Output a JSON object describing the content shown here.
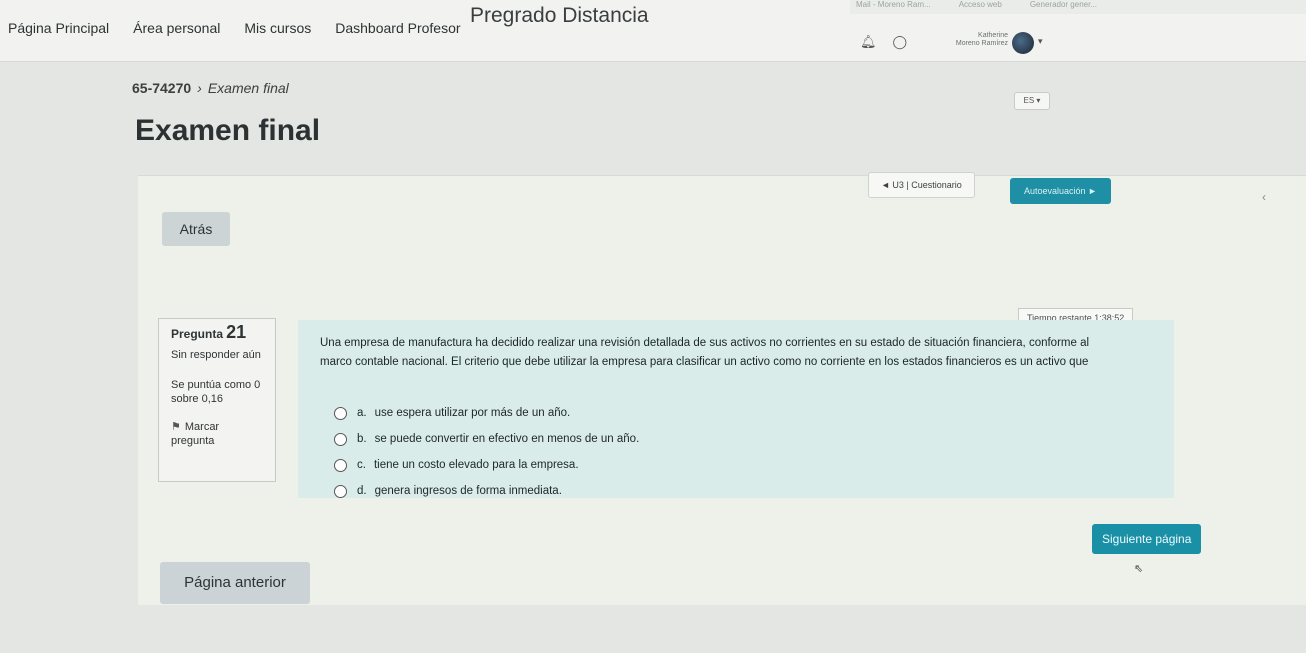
{
  "browser_bar": {
    "tabs": [
      "Mail - Moreno Ram...",
      "Acceso web",
      "Generador gener..."
    ]
  },
  "header": {
    "site_name": "Pregrado Distancia",
    "nav": [
      "Página Principal",
      "Área personal",
      "Mis cursos",
      "Dashboard Profesor"
    ],
    "user_first": "Katherine",
    "user_last": "Moreno Ramírez",
    "language": "ES"
  },
  "breadcrumb": {
    "course": "65-74270",
    "separator": "›",
    "current": "Examen final"
  },
  "page_title": "Examen final",
  "activity_nav": {
    "prev": "◄ U3 | Cuestionario",
    "next": "Autoevaluación ►"
  },
  "back_button": "Atrás",
  "timer": "Tiempo restante 1:38:52",
  "question": {
    "label": "Pregunta",
    "number": "21",
    "state": "Sin responder aún",
    "score": "Se puntúa como 0 sobre 0,16",
    "flag": "Marcar pregunta",
    "text_line1": "Una empresa de manufactura ha decidido realizar una revisión detallada de sus activos no corrientes en su estado de situación financiera, conforme al",
    "text_line2": "marco contable nacional. El criterio que debe utilizar la empresa para clasificar un activo como no corriente en los estados financieros es un activo que",
    "options": [
      {
        "letter": "a.",
        "text": "use espera utilizar por más de un año."
      },
      {
        "letter": "b.",
        "text": "se puede convertir en efectivo en menos de un año."
      },
      {
        "letter": "c.",
        "text": "tiene un costo elevado para la empresa."
      },
      {
        "letter": "d.",
        "text": "genera ingresos de forma inmediata."
      }
    ]
  },
  "next_page": "Siguiente página",
  "prev_page": "Página anterior"
}
